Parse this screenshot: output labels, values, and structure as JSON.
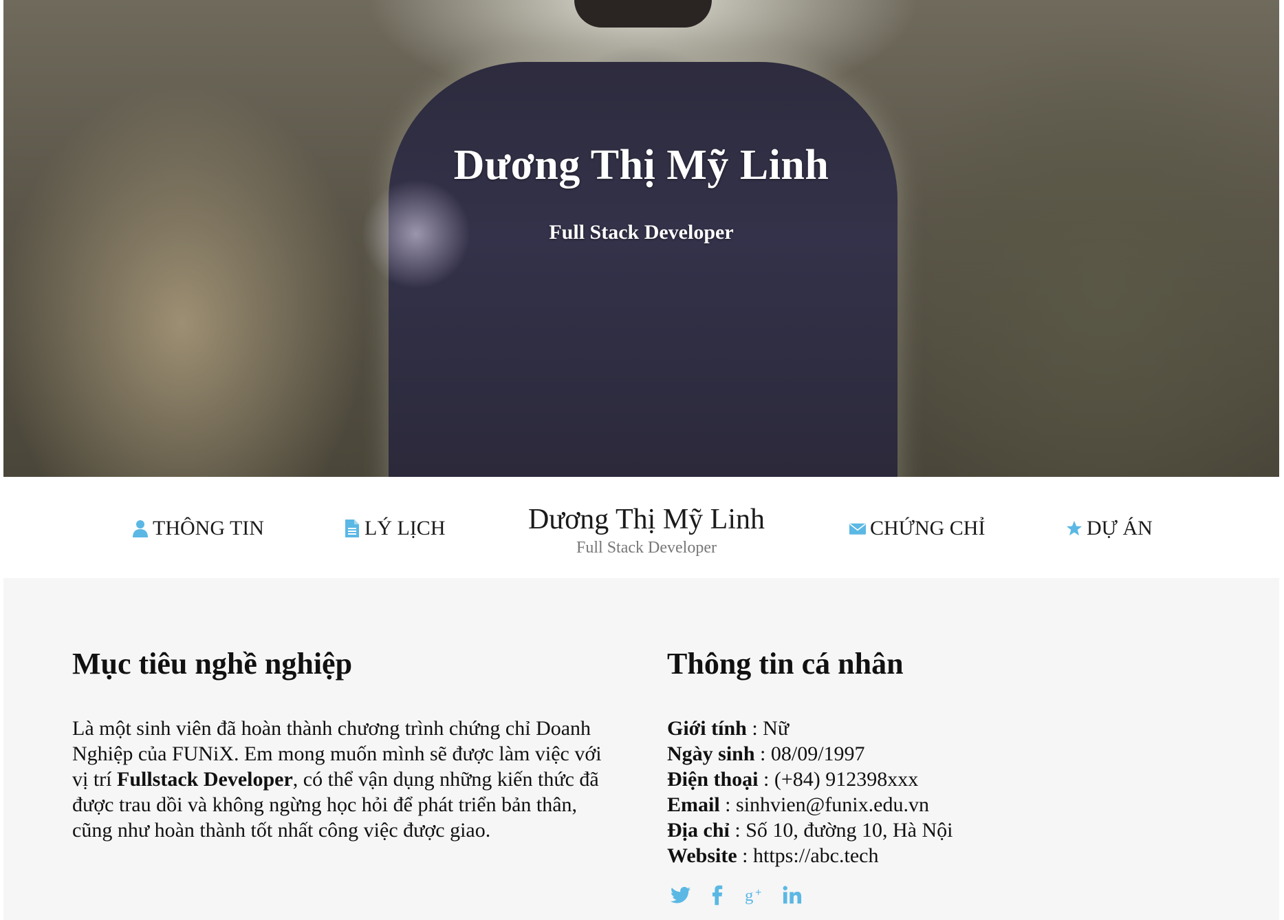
{
  "hero": {
    "name": "Dương Thị Mỹ Linh",
    "role": "Full Stack Developer"
  },
  "nav": {
    "items": [
      {
        "label": "THÔNG TIN",
        "icon": "user-icon"
      },
      {
        "label": "LÝ LỊCH",
        "icon": "document-icon"
      },
      {
        "label": "CHỨNG CHỈ",
        "icon": "envelope-icon"
      },
      {
        "label": "DỰ ÁN",
        "icon": "star-icon"
      }
    ],
    "brand_name": "Dương Thị Mỹ Linh",
    "brand_role": "Full Stack Developer"
  },
  "career": {
    "title": "Mục tiêu nghề nghiệp",
    "text_before": "Là một sinh viên đã hoàn thành chương trình chứng chỉ Doanh Nghiệp của FUNiX. Em mong muốn mình sẽ được làm việc với vị trí ",
    "text_bold": "Fullstack Developer",
    "text_after": ", có thể vận dụng những kiến thức đã được trau dồi và không ngừng học hỏi để phát triển bản thân, cũng như hoàn thành tốt nhất công việc được giao."
  },
  "personal": {
    "title": "Thông tin cá nhân",
    "fields": [
      {
        "key": "Giới tính",
        "value": "Nữ"
      },
      {
        "key": "Ngày sinh",
        "value": "08/09/1997"
      },
      {
        "key": "Điện thoại",
        "value": "(+84) 912398xxx"
      },
      {
        "key": "Email",
        "value": "sinhvien@funix.edu.vn"
      },
      {
        "key": "Địa chỉ",
        "value": "Số 10, đường 10, Hà Nội"
      },
      {
        "key": "Website",
        "value": "https://abc.tech"
      }
    ],
    "separator": " : "
  },
  "socials": [
    "twitter-icon",
    "facebook-icon",
    "google-plus-icon",
    "linkedin-icon"
  ],
  "colors": {
    "accent": "#5bb8e4",
    "content_bg": "#f6f6f6",
    "text": "#111111",
    "muted": "#777777"
  }
}
